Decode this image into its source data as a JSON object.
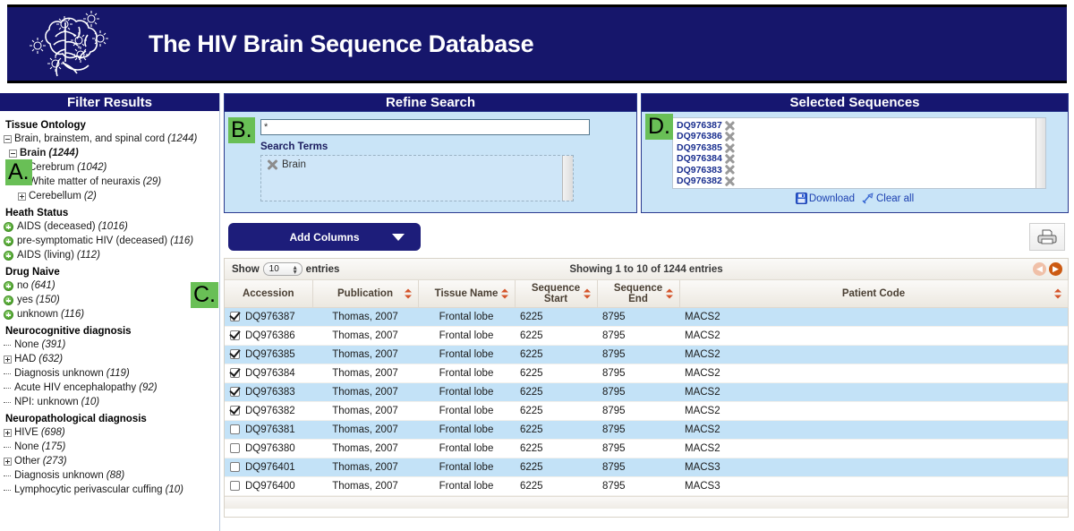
{
  "banner": {
    "title": "The HIV Brain Sequence Database",
    "logo_icon": "brain-virus-logo"
  },
  "markers": {
    "a": "A.",
    "b": "B.",
    "c": "C.",
    "d": "D."
  },
  "sidebar": {
    "title": "Filter Results",
    "groups": [
      {
        "heading": "Tissue Ontology",
        "items": [
          {
            "label": "Brain, brainstem, and spinal cord",
            "count": "(1244)",
            "toggle": "minus",
            "indent": 0,
            "bold": false
          },
          {
            "label": "Brain",
            "count": "(1244)",
            "toggle": "minus",
            "indent": 1,
            "bold": true
          },
          {
            "label": "Cerebrum",
            "count": "(1042)",
            "toggle": "plus",
            "indent": 2,
            "bold": false
          },
          {
            "label": "White matter of neuraxis",
            "count": "(29)",
            "toggle": "leaf",
            "indent": 2,
            "bold": false
          },
          {
            "label": "Cerebellum",
            "count": "(2)",
            "toggle": "plus",
            "indent": 2,
            "bold": false
          }
        ]
      },
      {
        "heading": "Heath Status",
        "items": [
          {
            "label": "AIDS (deceased)",
            "count": "(1016)",
            "toggle": "gplus",
            "indent": 0,
            "bold": false
          },
          {
            "label": "pre-symptomatic HIV (deceased)",
            "count": "(116)",
            "toggle": "gplus",
            "indent": 0,
            "bold": false
          },
          {
            "label": "AIDS (living)",
            "count": "(112)",
            "toggle": "gplus",
            "indent": 0,
            "bold": false
          }
        ]
      },
      {
        "heading": "Drug Naive",
        "items": [
          {
            "label": "no",
            "count": "(641)",
            "toggle": "gplus",
            "indent": 0,
            "bold": false
          },
          {
            "label": "yes",
            "count": "(150)",
            "toggle": "gplus",
            "indent": 0,
            "bold": false
          },
          {
            "label": "unknown",
            "count": "(116)",
            "toggle": "gplus",
            "indent": 0,
            "bold": false
          }
        ]
      },
      {
        "heading": "Neurocognitive diagnosis",
        "items": [
          {
            "label": "None",
            "count": "(391)",
            "toggle": "leaf",
            "indent": 0,
            "bold": false
          },
          {
            "label": "HAD",
            "count": "(632)",
            "toggle": "plus",
            "indent": 0,
            "bold": false
          },
          {
            "label": "Diagnosis unknown",
            "count": "(119)",
            "toggle": "leaf",
            "indent": 0,
            "bold": false
          },
          {
            "label": "Acute HIV encephalopathy",
            "count": "(92)",
            "toggle": "leaf",
            "indent": 0,
            "bold": false
          },
          {
            "label": "NPI: unknown",
            "count": "(10)",
            "toggle": "leaf",
            "indent": 0,
            "bold": false
          }
        ]
      },
      {
        "heading": "Neuropathological diagnosis",
        "items": [
          {
            "label": "HIVE",
            "count": "(698)",
            "toggle": "plus",
            "indent": 0,
            "bold": false
          },
          {
            "label": "None",
            "count": "(175)",
            "toggle": "leaf",
            "indent": 0,
            "bold": false
          },
          {
            "label": "Other",
            "count": "(273)",
            "toggle": "plus",
            "indent": 0,
            "bold": false
          },
          {
            "label": "Diagnosis unknown",
            "count": "(88)",
            "toggle": "leaf",
            "indent": 0,
            "bold": false
          },
          {
            "label": "Lymphocytic perivascular cuffing",
            "count": "(10)",
            "toggle": "leaf",
            "indent": 0,
            "bold": false
          }
        ]
      }
    ]
  },
  "refine": {
    "title": "Refine Search",
    "search_value": "*",
    "search_placeholder": "",
    "terms_label": "Search Terms",
    "terms": [
      {
        "label": "Brain",
        "remove_icon": "x-icon"
      }
    ]
  },
  "selected": {
    "title": "Selected Sequences",
    "items": [
      "DQ976387",
      "DQ976386",
      "DQ976385",
      "DQ976384",
      "DQ976383",
      "DQ976382"
    ],
    "download_label": "Download",
    "download_icon": "save-disk-icon",
    "clear_label": "Clear all",
    "clear_icon": "broom-icon"
  },
  "toolbar": {
    "add_columns_label": "Add Columns",
    "caret_icon": "chevron-down-icon",
    "print_icon": "printer-icon"
  },
  "results": {
    "show_label": "Show",
    "entries_value": "10",
    "entries_label": "entries",
    "showing_info": "Showing 1 to 10 of 1244 entries",
    "prev_icon": "arrow-left-icon",
    "next_icon": "arrow-right-icon",
    "columns": [
      {
        "label": "Accession",
        "sortable": false
      },
      {
        "label": "Publication",
        "sortable": true
      },
      {
        "label": "Tissue Name",
        "sortable": true
      },
      {
        "label": "Sequence Start",
        "sortable": true
      },
      {
        "label": "Sequence End",
        "sortable": true
      },
      {
        "label": "Patient Code",
        "sortable": true
      }
    ],
    "rows": [
      {
        "checked": true,
        "accession": "DQ976387",
        "publication": "Thomas, 2007",
        "tissue": "Frontal lobe",
        "start": "6225",
        "end": "8795",
        "patient": "MACS2"
      },
      {
        "checked": true,
        "accession": "DQ976386",
        "publication": "Thomas, 2007",
        "tissue": "Frontal lobe",
        "start": "6225",
        "end": "8795",
        "patient": "MACS2"
      },
      {
        "checked": true,
        "accession": "DQ976385",
        "publication": "Thomas, 2007",
        "tissue": "Frontal lobe",
        "start": "6225",
        "end": "8795",
        "patient": "MACS2"
      },
      {
        "checked": true,
        "accession": "DQ976384",
        "publication": "Thomas, 2007",
        "tissue": "Frontal lobe",
        "start": "6225",
        "end": "8795",
        "patient": "MACS2"
      },
      {
        "checked": true,
        "accession": "DQ976383",
        "publication": "Thomas, 2007",
        "tissue": "Frontal lobe",
        "start": "6225",
        "end": "8795",
        "patient": "MACS2"
      },
      {
        "checked": true,
        "accession": "DQ976382",
        "publication": "Thomas, 2007",
        "tissue": "Frontal lobe",
        "start": "6225",
        "end": "8795",
        "patient": "MACS2"
      },
      {
        "checked": false,
        "accession": "DQ976381",
        "publication": "Thomas, 2007",
        "tissue": "Frontal lobe",
        "start": "6225",
        "end": "8795",
        "patient": "MACS2"
      },
      {
        "checked": false,
        "accession": "DQ976380",
        "publication": "Thomas, 2007",
        "tissue": "Frontal lobe",
        "start": "6225",
        "end": "8795",
        "patient": "MACS2"
      },
      {
        "checked": false,
        "accession": "DQ976401",
        "publication": "Thomas, 2007",
        "tissue": "Frontal lobe",
        "start": "6225",
        "end": "8795",
        "patient": "MACS3"
      },
      {
        "checked": false,
        "accession": "DQ976400",
        "publication": "Thomas, 2007",
        "tissue": "Frontal lobe",
        "start": "6225",
        "end": "8795",
        "patient": "MACS3"
      }
    ]
  },
  "colors": {
    "navy": "#16166b",
    "panel_blue": "#c9e4f7",
    "row_blue": "#c3e2f7",
    "marker_green": "#69bf56",
    "link_blue": "#1b3fb0",
    "accent_orange": "#cc5a12"
  }
}
